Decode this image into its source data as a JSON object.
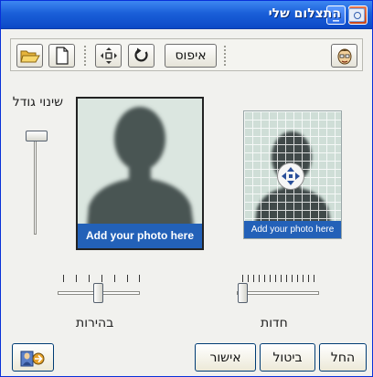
{
  "window": {
    "title": "התצלום שלי",
    "minimize_label": "_",
    "close_label": "×"
  },
  "toolbar": {
    "reset_label": "איפוס",
    "icons": [
      "open-folder-icon",
      "new-page-icon",
      "move-icon",
      "rotate-icon",
      "user-avatar-icon"
    ]
  },
  "size_slider": {
    "label": "שינוי גודל",
    "value": 0.95
  },
  "photo": {
    "caption": "Add your photo here"
  },
  "preview": {
    "caption": "Add your photo here"
  },
  "brightness": {
    "label": "בהירות",
    "value": 0.5
  },
  "sharpness": {
    "label": "חדות",
    "value": 0.0
  },
  "buttons": {
    "apply": "החל",
    "cancel": "ביטול",
    "ok": "אישור"
  },
  "colors": {
    "title_blue": "#0b49c7",
    "caption_blue": "#2361b8",
    "silhouette": "#4a5553"
  }
}
